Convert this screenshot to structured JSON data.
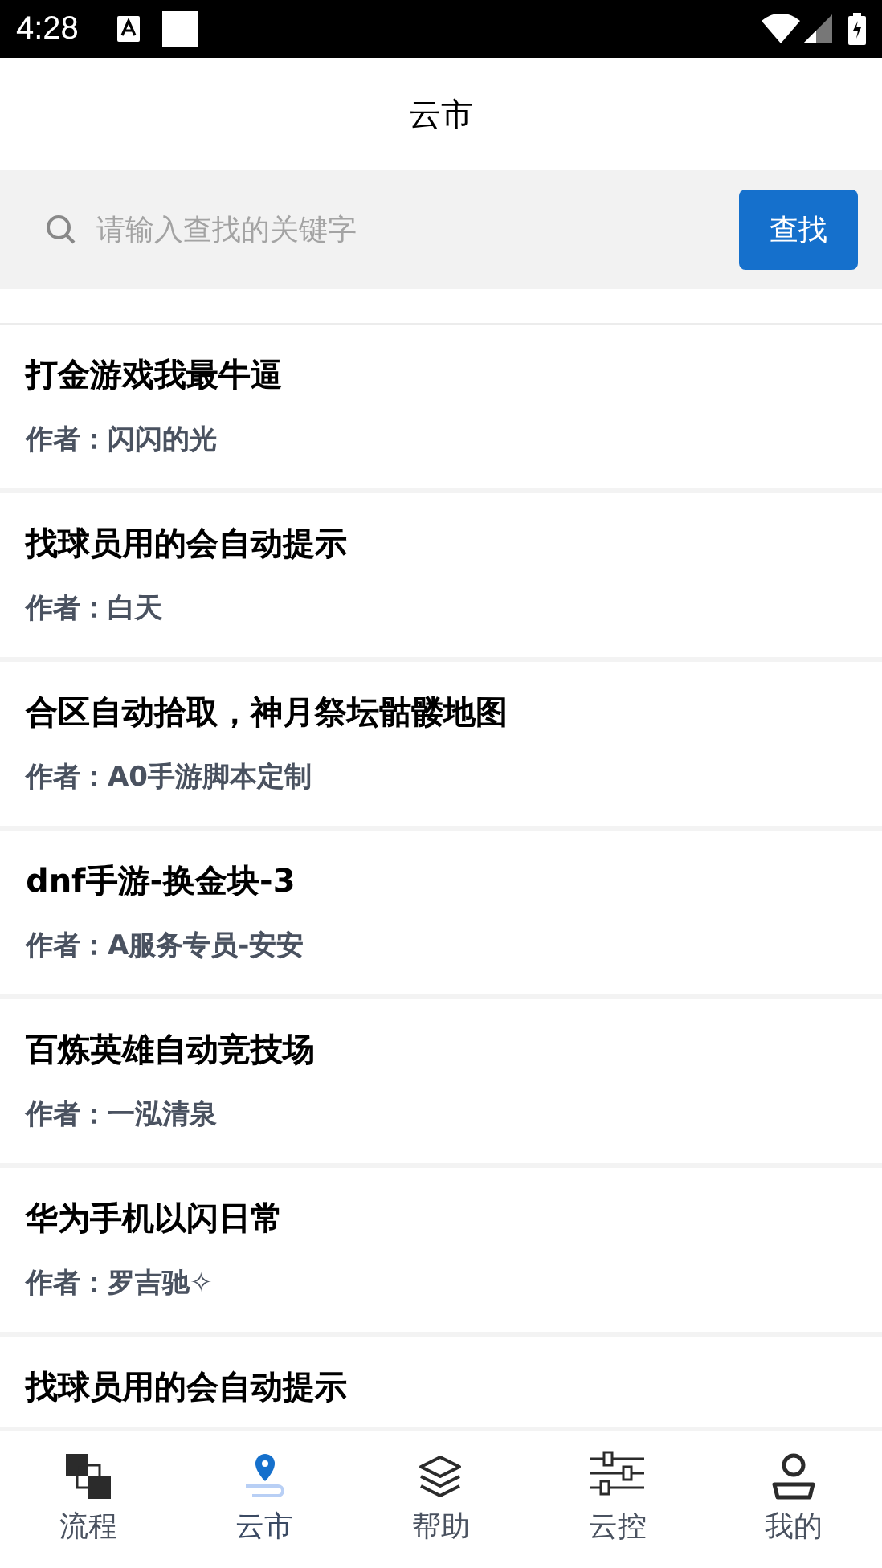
{
  "status_bar": {
    "time": "4:28"
  },
  "header": {
    "title": "云市"
  },
  "search": {
    "placeholder": "请输入查找的关键字",
    "button": "查找"
  },
  "items": [
    {
      "title": "打金游戏我最牛逼",
      "author": "作者：闪闪的光"
    },
    {
      "title": "找球员用的会自动提示",
      "author": "作者：白天"
    },
    {
      "title": "合区自动拾取，神月祭坛骷髅地图",
      "author": "作者：A0手游脚本定制"
    },
    {
      "title": "dnf手游-换金块-3",
      "author": "作者：A服务专员-安安"
    },
    {
      "title": "百炼英雄自动竞技场",
      "author": "作者：一泓清泉"
    },
    {
      "title": "华为手机以闪日常",
      "author": "作者：罗吉驰✧"
    },
    {
      "title": "找球员用的会自动提示"
    }
  ],
  "tabs": [
    {
      "kind": "flow",
      "label": "流程",
      "selected": false
    },
    {
      "kind": "market",
      "label": "云市",
      "selected": true
    },
    {
      "kind": "help",
      "label": "帮助",
      "selected": false
    },
    {
      "kind": "control",
      "label": "云控",
      "selected": false
    },
    {
      "kind": "user",
      "label": "我的",
      "selected": false
    }
  ]
}
